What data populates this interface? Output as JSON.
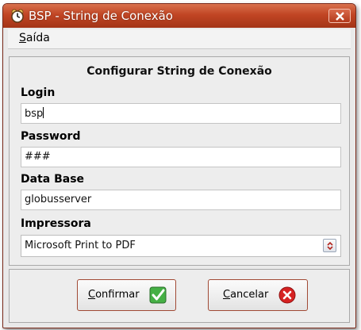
{
  "window": {
    "title": "BSP - String de Conexão"
  },
  "menu": {
    "saida_prefix": "S",
    "saida_rest": "aída"
  },
  "form": {
    "heading": "Configurar String de Conexão",
    "login_label": "Login",
    "login_value": "bsp",
    "password_label": "Password",
    "password_value": "###",
    "database_label": "Data Base",
    "database_value": "globusserver",
    "printer_label": "Impressora",
    "printer_value": "Microsoft Print to PDF"
  },
  "buttons": {
    "confirm_prefix": "C",
    "confirm_rest": "onfirmar",
    "cancel_prefix": "C",
    "cancel_rest": "ancelar"
  },
  "colors": {
    "titlebar": "#c14524",
    "confirm_icon": "#3aa63a",
    "cancel_icon": "#d62222"
  },
  "icons": [
    "app-clock-icon",
    "close-icon",
    "select-arrows-icon",
    "checkmark-icon",
    "cancel-x-icon"
  ]
}
